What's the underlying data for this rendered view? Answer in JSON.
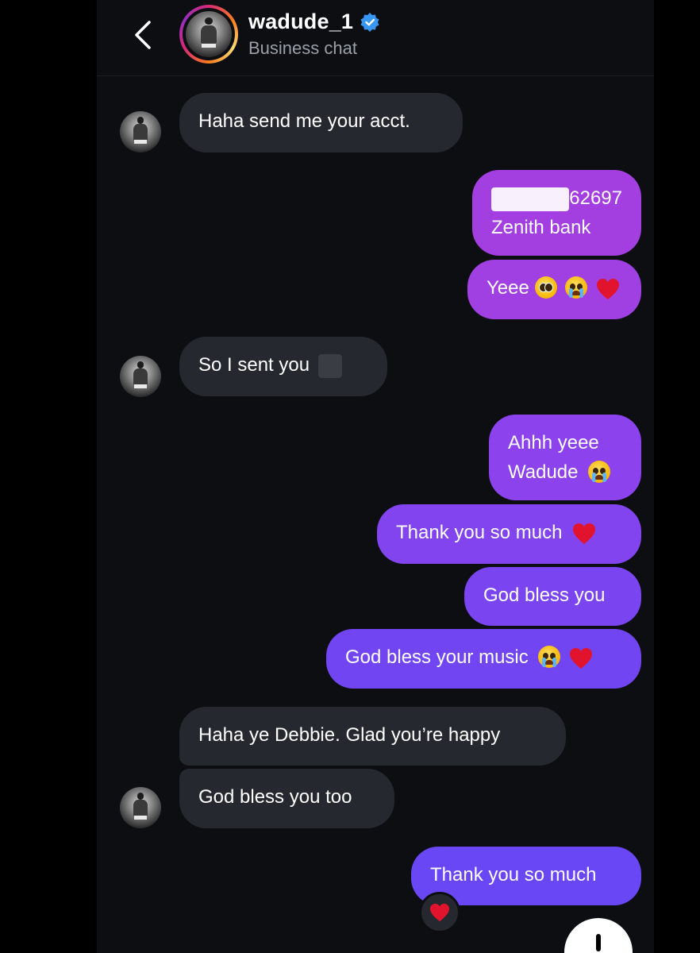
{
  "header": {
    "username": "wadude_1",
    "subtitle": "Business chat"
  },
  "messages": [
    {
      "side": "in",
      "text": "Haha send me your acct."
    },
    {
      "side": "out",
      "line1": "62697",
      "line2": "Zenith bank"
    },
    {
      "side": "out",
      "text": "Yeee",
      "emoji": [
        "pleading-face",
        "loudly-crying-face",
        "red-heart"
      ]
    },
    {
      "side": "in",
      "text": "So I sent you"
    },
    {
      "side": "out",
      "line1": "Ahhh yeee",
      "line2": "Wadude",
      "emoji": [
        "loudly-crying-face"
      ]
    },
    {
      "side": "out",
      "text": "Thank you so much",
      "emoji": [
        "red-heart"
      ]
    },
    {
      "side": "out",
      "text": "God bless you"
    },
    {
      "side": "out",
      "text": "God bless your music",
      "emoji": [
        "loudly-crying-face",
        "red-heart"
      ]
    },
    {
      "side": "in",
      "text": "Haha ye Debbie. Glad you’re happy"
    },
    {
      "side": "in",
      "text": "God bless you too"
    },
    {
      "side": "out",
      "text": "Thank you so much",
      "reaction": "red-heart"
    }
  ],
  "colors": {
    "background": "#0c0e12",
    "incoming_bubble": "#25282e",
    "outgoing_top": "#a33ee0",
    "outgoing_bottom": "#6b47f5",
    "verified": "#3897f0",
    "heart": "#e2142d"
  },
  "icons": {
    "back": "chevron-left-icon",
    "verified": "verified-badge-icon",
    "reaction": "red-heart-icon",
    "scroll": "scroll-down-icon"
  }
}
